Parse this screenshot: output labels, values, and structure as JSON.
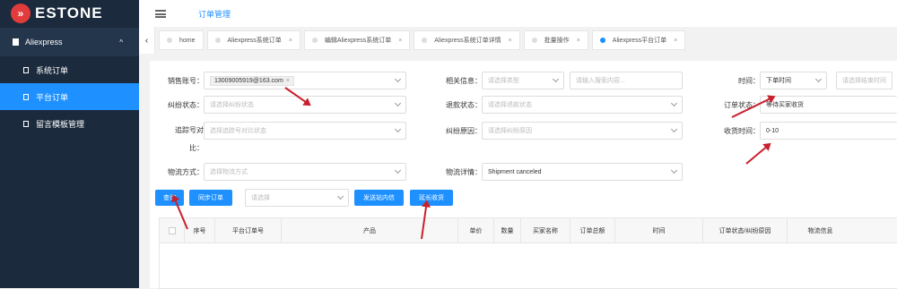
{
  "brand": {
    "name": "ESTONE"
  },
  "header": {
    "title": "订单管理"
  },
  "sidebar": {
    "group": "Aliexpress",
    "items": [
      {
        "label": "系统订单"
      },
      {
        "label": "平台订单"
      },
      {
        "label": "留言模板管理"
      }
    ]
  },
  "tabs": [
    {
      "label": "home"
    },
    {
      "label": "Aliexpress系统订单"
    },
    {
      "label": "编辑Aliexpress系统订单"
    },
    {
      "label": "Aliexpress系统订单详情"
    },
    {
      "label": "批量操作"
    },
    {
      "label": "Aliexpress平台订单"
    }
  ],
  "filters": {
    "account_label": "销售账号：",
    "account_value": "13009005919@163.com",
    "related_label": "相关信息：",
    "related_placeholder": "请选择类型",
    "related_input_placeholder": "请输入搜索内容...",
    "time_label": "时间：",
    "time_value": "下单时间",
    "time_end_placeholder": "请选择结束时间",
    "dispute_label": "纠纷状态：",
    "dispute_placeholder": "请选择纠纷状态",
    "refund_label": "退款状态：",
    "refund_placeholder": "请选择退款状态",
    "order_status_label": "订单状态：",
    "order_status_value": "等待买家收货",
    "tracking_label_1": "追踪号对",
    "tracking_label_2": "比：",
    "tracking_placeholder": "选择追踪号对比状态",
    "dispute_reason_label": "纠纷原因：",
    "dispute_reason_placeholder": "请选择纠纷原因",
    "receive_time_label": "收货时间：",
    "receive_time_value": "0-10",
    "logistics_label": "物流方式：",
    "logistics_placeholder": "选择物流方式",
    "logistics_detail_label": "物流详情：",
    "logistics_detail_value": "Shipment canceled"
  },
  "actions": {
    "query": "查询",
    "sync": "同步订单",
    "select_placeholder": "请选择",
    "send_message": "发送站内信",
    "extend_receive": "延长收货"
  },
  "table": {
    "columns": [
      "序号",
      "平台订单号",
      "产品",
      "单价",
      "数量",
      "买家名称",
      "订单总额",
      "时间",
      "订单状态/纠纷原因",
      "物流信息"
    ]
  },
  "colors": {
    "accent": "#1e90ff",
    "sidebar": "#1b2a3d",
    "annotation": "#c8202c"
  }
}
